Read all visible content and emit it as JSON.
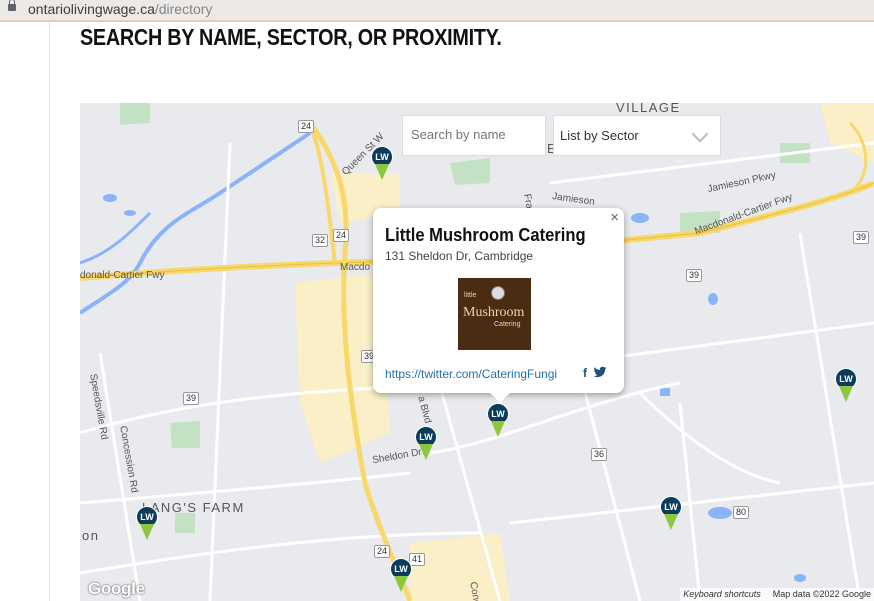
{
  "browser": {
    "url_host": "ontariolivingwage.ca",
    "url_path": "/directory"
  },
  "heading": "SEARCH BY NAME, SECTOR, OR PROXIMITY.",
  "search": {
    "placeholder": "Search by name"
  },
  "sector_select": {
    "value": "List by Sector"
  },
  "map": {
    "road_labels": {
      "queen_st": "Queen St W",
      "jamieson_pkwy": "Jamieson Pkwy",
      "jamieson_partial": "Jamieson",
      "macdonald_cartier_right": "Macdonald-Cartier Fwy",
      "macdonald_cartier_left": "donald-Cartier Fwy",
      "macdo_partial": "Macdo",
      "speedsville_rd": "Speedsville Rd",
      "concession_rd": "Concession Rd",
      "sheldon_dr": "Sheldon Dr",
      "blvd_partial": "a Blvd",
      "fra_partial": "Fra",
      "e_partial": "E",
      "conc_partial": "Conc"
    },
    "area_labels": {
      "village": "VILLAGE",
      "langs_farm": "LANG'S FARM",
      "on_partial": "on"
    },
    "route_shields": {
      "r24a": "24",
      "r32": "32",
      "r24b": "24",
      "r39a": "39",
      "r39b": "39",
      "r39c": "39",
      "r39d": "39",
      "r36": "36",
      "r80": "80",
      "r24c": "24",
      "r41": "41"
    },
    "marker_label": "LW",
    "google_logo": "Google",
    "keyboard_shortcuts": "Keyboard shortcuts",
    "map_data": "Map data ©2022 Google"
  },
  "popup": {
    "close": "×",
    "title": "Little Mushroom Catering",
    "address": "131 Sheldon Dr, Cambridge",
    "logo_line1": "little",
    "logo_line2": "Mushroom",
    "logo_line3": "Catering",
    "link": "https://twitter.com/CateringFungi",
    "facebook_glyph": "f"
  },
  "colors": {
    "marker": "#0b3c5d",
    "marker_tip": "#8dc63f",
    "highway": "#f8d86a",
    "water": "#8ab4f8",
    "park": "#c3e2c3",
    "urban": "#fbefc8"
  }
}
